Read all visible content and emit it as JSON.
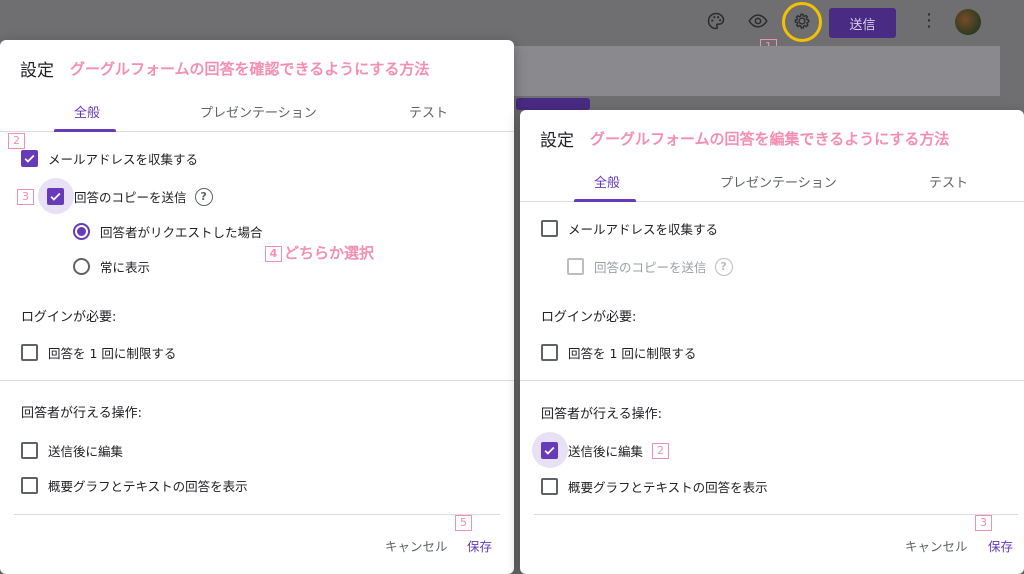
{
  "toolbar": {
    "send_label": "送信",
    "icons": [
      "palette-icon",
      "eye-icon",
      "gear-icon",
      "more-icon"
    ],
    "gear_callout": "1"
  },
  "left_dialog": {
    "title": "設定",
    "subtitle": "グーグルフォームの回答を確認できるようにする方法",
    "tabs": [
      "全般",
      "プレゼンテーション",
      "テスト"
    ],
    "collect_email": {
      "label": "メールアドレスを収集する",
      "checked": true,
      "callout": "2"
    },
    "copy_responses": {
      "label": "回答のコピーを送信",
      "checked": true,
      "callout": "3"
    },
    "radio_options": [
      {
        "label": "回答者がリクエストした場合",
        "selected": true
      },
      {
        "label": "常に表示",
        "selected": false
      }
    ],
    "radio_note": "④どちらか選択",
    "radio_note_num": "4",
    "radio_note_text": "どちらか選択",
    "login_required": "ログインが必要:",
    "limit_one": {
      "label": "回答を 1 回に制限する",
      "checked": false
    },
    "respondent_actions": "回答者が行える操作:",
    "edit_after_submit": {
      "label": "送信後に編集",
      "checked": false
    },
    "view_summary": {
      "label": "概要グラフとテキストの回答を表示",
      "checked": false
    },
    "cancel_label": "キャンセル",
    "save_label": "保存",
    "save_callout": "5"
  },
  "right_dialog": {
    "title": "設定",
    "subtitle": "グーグルフォームの回答を編集できるようにする方法",
    "tabs": [
      "全般",
      "プレゼンテーション",
      "テスト"
    ],
    "collect_email": {
      "label": "メールアドレスを収集する",
      "checked": false
    },
    "copy_responses": {
      "label": "回答のコピーを送信",
      "checked": false,
      "disabled": true
    },
    "login_required": "ログインが必要:",
    "limit_one": {
      "label": "回答を 1 回に制限する",
      "checked": false
    },
    "respondent_actions": "回答者が行える操作:",
    "edit_after_submit": {
      "label": "送信後に編集",
      "checked": true,
      "callout": "2"
    },
    "view_summary": {
      "label": "概要グラフとテキストの回答を表示",
      "checked": false
    },
    "cancel_label": "キャンセル",
    "save_label": "保存",
    "save_callout": "3"
  },
  "colors": {
    "accent": "#673ab7",
    "callout": "#f48fb1",
    "highlight_ring": "#f2c200"
  }
}
